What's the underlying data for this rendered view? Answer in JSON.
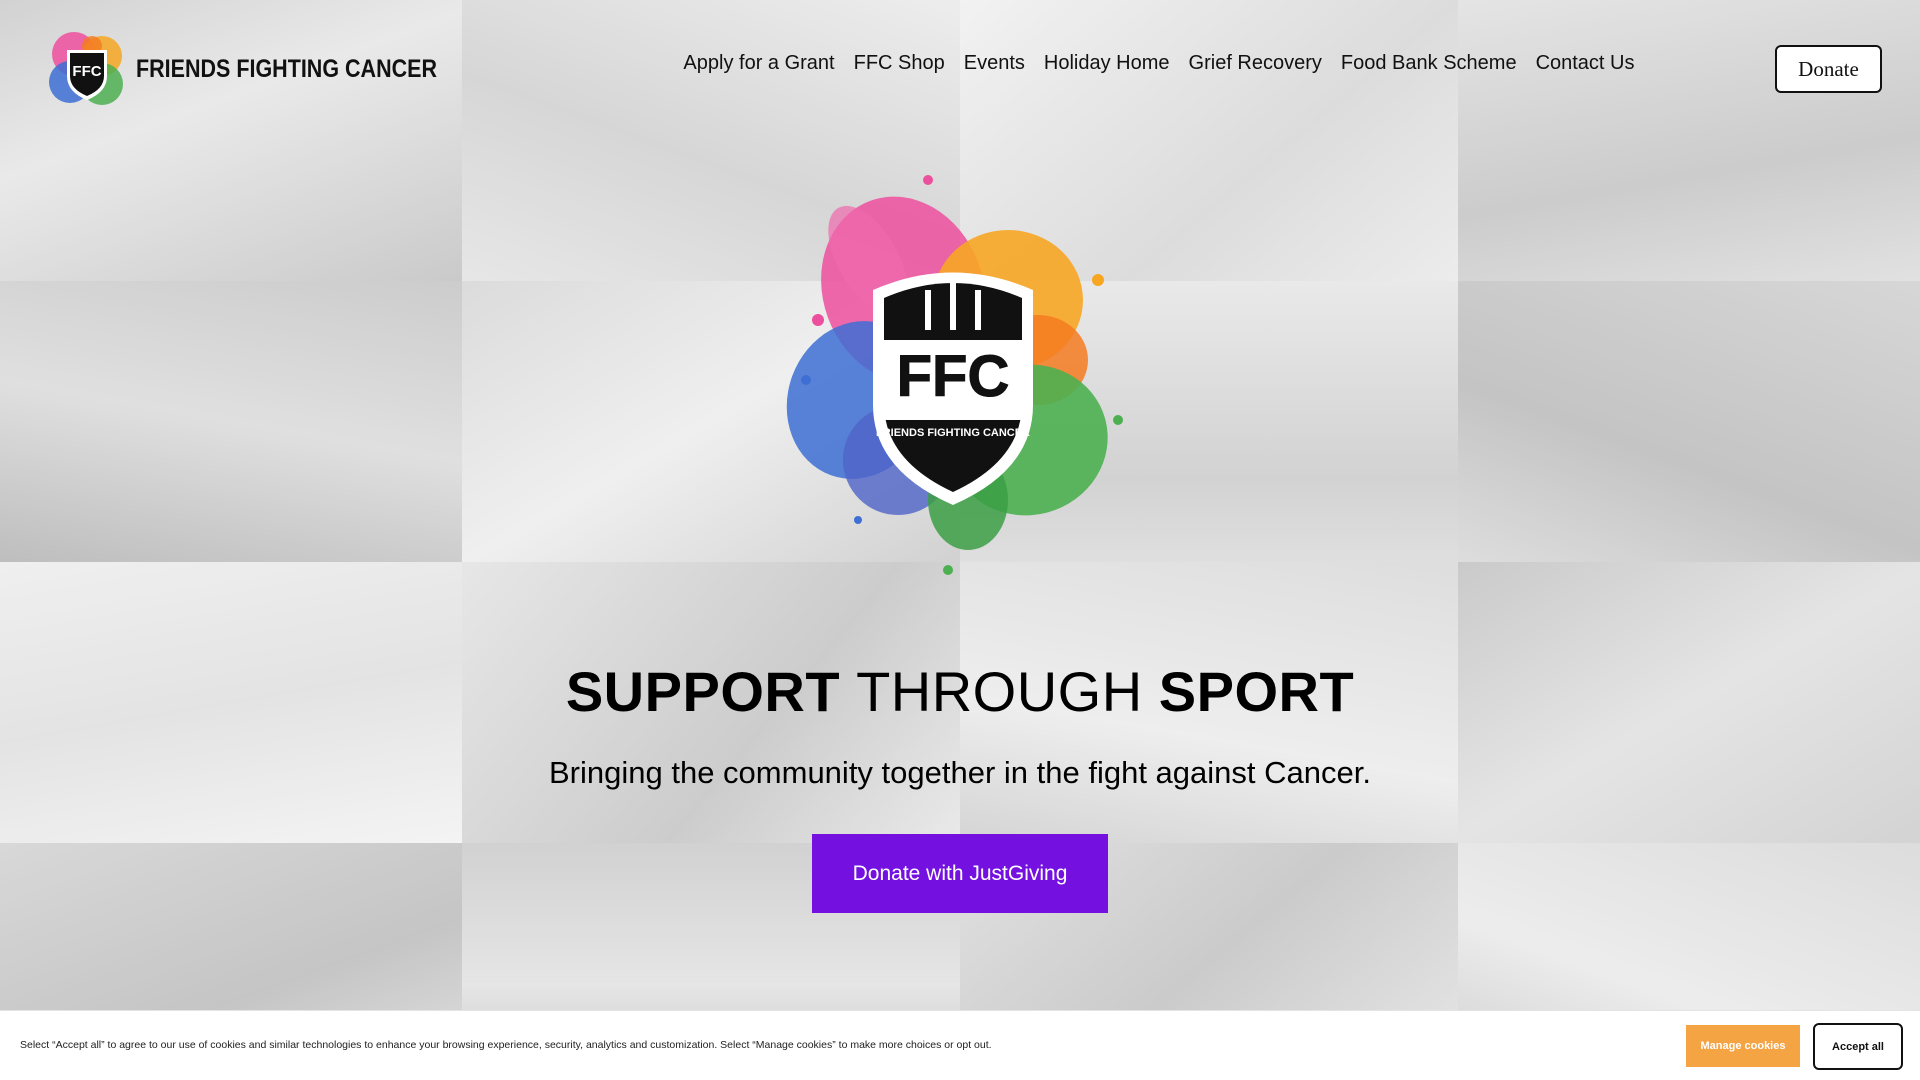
{
  "brand": {
    "name": "FRIENDS FIGHTING CANCER",
    "emblem_letters": "FFC",
    "emblem_caption": "FRIENDS FIGHTING CANCER",
    "splash_colors": [
      "#ec4f9d",
      "#f6a623",
      "#f47b20",
      "#4caf50",
      "#3d6fd4",
      "#8e44ad"
    ]
  },
  "nav": {
    "items": [
      {
        "label": "Apply for a Grant"
      },
      {
        "label": "FFC Shop"
      },
      {
        "label": "Events"
      },
      {
        "label": "Holiday Home"
      },
      {
        "label": "Grief Recovery"
      },
      {
        "label": "Food Bank Scheme"
      },
      {
        "label": "Contact Us"
      }
    ],
    "donate_label": "Donate"
  },
  "hero": {
    "title_part1": "SUPPORT",
    "title_part2": "THROUGH",
    "title_part3": "SPORT",
    "subtitle": "Bringing the community together in the fight against Cancer.",
    "cta_label": "Donate with JustGiving",
    "cta_color": "#7411e0"
  },
  "cookie_banner": {
    "text": "Select “Accept all” to agree to our use of cookies and similar technologies to enhance your browsing experience, security, analytics and customization. Select “Manage cookies” to make more choices or opt out.",
    "manage_label": "Manage cookies",
    "accept_label": "Accept all",
    "manage_color": "#f5a444"
  }
}
